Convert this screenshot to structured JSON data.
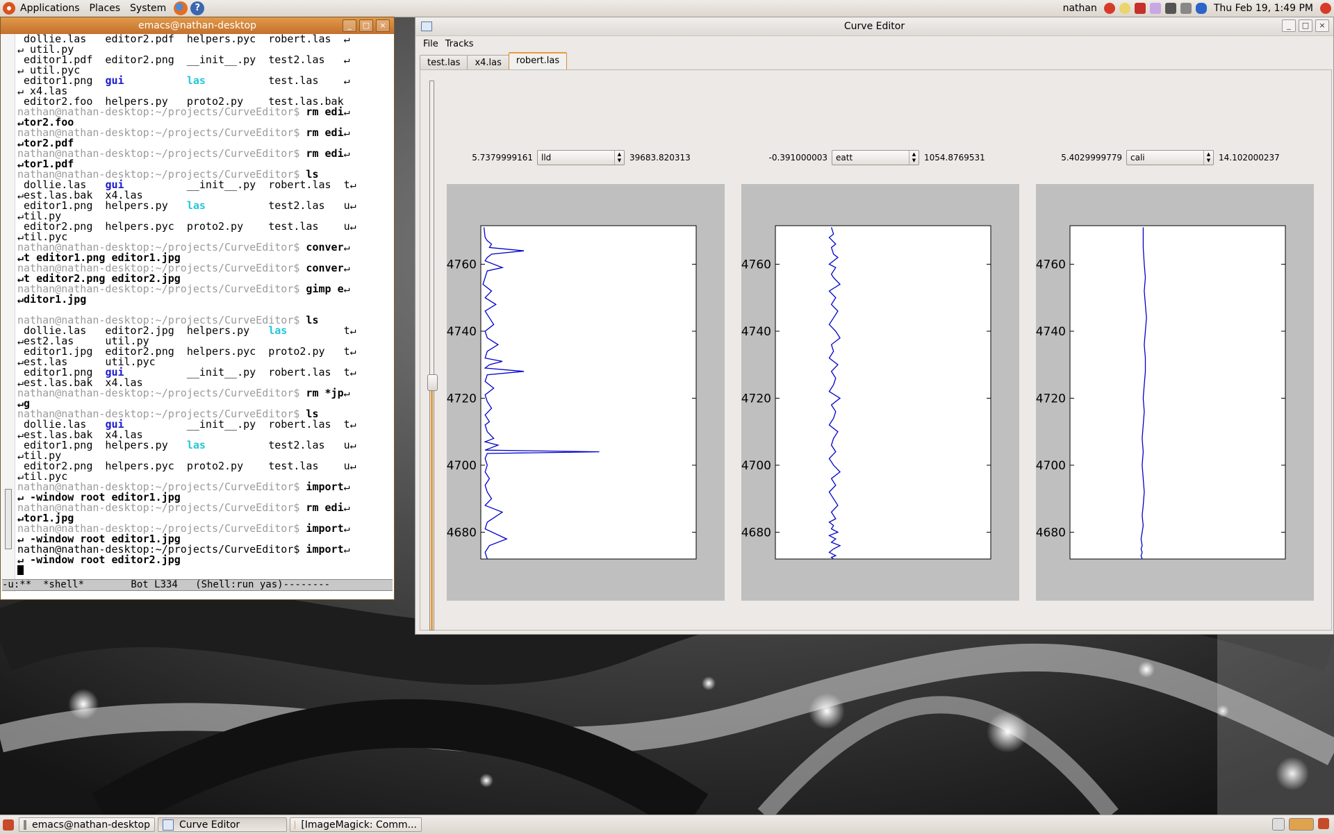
{
  "top_panel": {
    "menus": [
      "Applications",
      "Places",
      "System"
    ],
    "user": "nathan",
    "clock": "Thu Feb 19,  1:49 PM"
  },
  "emacs": {
    "title": "emacs@nathan-desktop",
    "modeline": "-u:**  *shell*        Bot L334   (Shell:run yas)--------",
    "prompt": "nathan@nathan-desktop:~/projects/CurveEditor$ ",
    "lines": [
      [
        [
          "t",
          " dollie.las   editor2.pdf  helpers.pyc  robert.las  "
        ],
        [
          "t",
          "↵"
        ]
      ],
      [
        [
          "t",
          "↵ util.py"
        ]
      ],
      [
        [
          "t",
          " editor1.pdf  editor2.png  __init__.py  test2.las   "
        ],
        [
          "t",
          "↵"
        ]
      ],
      [
        [
          "t",
          "↵ util.pyc"
        ]
      ],
      [
        [
          "t",
          " editor1.png  "
        ],
        [
          "gui",
          "gui"
        ],
        [
          "t",
          "          "
        ],
        [
          "las",
          "las"
        ],
        [
          "t",
          "          test.las    "
        ],
        [
          "t",
          "↵"
        ]
      ],
      [
        [
          "t",
          "↵ x4.las"
        ]
      ],
      [
        [
          "t",
          " editor2.foo  helpers.py   proto2.py    test.las.bak"
        ]
      ],
      [
        [
          "p",
          "prompt"
        ],
        [
          "c",
          "rm edi"
        ],
        [
          "t",
          "↵"
        ]
      ],
      [
        [
          "c",
          "↵tor2.foo"
        ]
      ],
      [
        [
          "p",
          "prompt"
        ],
        [
          "c",
          "rm edi"
        ],
        [
          "t",
          "↵"
        ]
      ],
      [
        [
          "c",
          "↵tor2.pdf"
        ]
      ],
      [
        [
          "p",
          "prompt"
        ],
        [
          "c",
          "rm edi"
        ],
        [
          "t",
          "↵"
        ]
      ],
      [
        [
          "c",
          "↵tor1.pdf"
        ]
      ],
      [
        [
          "p",
          "prompt"
        ],
        [
          "c",
          "ls"
        ]
      ],
      [
        [
          "t",
          " dollie.las   "
        ],
        [
          "gui",
          "gui"
        ],
        [
          "t",
          "          __init__.py  robert.las  t"
        ],
        [
          "t",
          "↵"
        ]
      ],
      [
        [
          "t",
          "↵est.las.bak  x4.las"
        ]
      ],
      [
        [
          "t",
          " editor1.png  helpers.py   "
        ],
        [
          "las",
          "las"
        ],
        [
          "t",
          "          test2.las   u"
        ],
        [
          "t",
          "↵"
        ]
      ],
      [
        [
          "t",
          "↵til.py"
        ]
      ],
      [
        [
          "t",
          " editor2.png  helpers.pyc  proto2.py    test.las    u"
        ],
        [
          "t",
          "↵"
        ]
      ],
      [
        [
          "t",
          "↵til.pyc"
        ]
      ],
      [
        [
          "p",
          "prompt"
        ],
        [
          "c",
          "conver"
        ],
        [
          "t",
          "↵"
        ]
      ],
      [
        [
          "c",
          "↵t editor1.png editor1.jpg"
        ]
      ],
      [
        [
          "p",
          "prompt"
        ],
        [
          "c",
          "conver"
        ],
        [
          "t",
          "↵"
        ]
      ],
      [
        [
          "c",
          "↵t editor2.png editor2.jpg"
        ]
      ],
      [
        [
          "p",
          "prompt"
        ],
        [
          "c",
          "gimp e"
        ],
        [
          "t",
          "↵"
        ]
      ],
      [
        [
          "c",
          "↵ditor1.jpg"
        ]
      ],
      [
        [
          "t",
          ""
        ]
      ],
      [
        [
          "p",
          "prompt"
        ],
        [
          "c",
          "ls"
        ]
      ],
      [
        [
          "t",
          " dollie.las   editor2.jpg  helpers.py   "
        ],
        [
          "las",
          "las"
        ],
        [
          "t",
          "         t"
        ],
        [
          "t",
          "↵"
        ]
      ],
      [
        [
          "t",
          "↵est2.las     util.py"
        ]
      ],
      [
        [
          "t",
          " editor1.jpg  editor2.png  helpers.pyc  proto2.py   t"
        ],
        [
          "t",
          "↵"
        ]
      ],
      [
        [
          "t",
          "↵est.las      util.pyc"
        ]
      ],
      [
        [
          "t",
          " editor1.png  "
        ],
        [
          "gui",
          "gui"
        ],
        [
          "t",
          "          __init__.py  robert.las  t"
        ],
        [
          "t",
          "↵"
        ]
      ],
      [
        [
          "t",
          "↵est.las.bak  x4.las"
        ]
      ],
      [
        [
          "p",
          "prompt"
        ],
        [
          "c",
          "rm *jp"
        ],
        [
          "t",
          "↵"
        ]
      ],
      [
        [
          "c",
          "↵g"
        ]
      ],
      [
        [
          "p",
          "prompt"
        ],
        [
          "c",
          "ls"
        ]
      ],
      [
        [
          "t",
          " dollie.las   "
        ],
        [
          "gui",
          "gui"
        ],
        [
          "t",
          "          __init__.py  robert.las  t"
        ],
        [
          "t",
          "↵"
        ]
      ],
      [
        [
          "t",
          "↵est.las.bak  x4.las"
        ]
      ],
      [
        [
          "t",
          " editor1.png  helpers.py   "
        ],
        [
          "las",
          "las"
        ],
        [
          "t",
          "          test2.las   u"
        ],
        [
          "t",
          "↵"
        ]
      ],
      [
        [
          "t",
          "↵til.py"
        ]
      ],
      [
        [
          "t",
          " editor2.png  helpers.pyc  proto2.py    test.las    u"
        ],
        [
          "t",
          "↵"
        ]
      ],
      [
        [
          "t",
          "↵til.pyc"
        ]
      ],
      [
        [
          "p",
          "prompt"
        ],
        [
          "c",
          "import"
        ],
        [
          "t",
          "↵"
        ]
      ],
      [
        [
          "c",
          "↵ -window root editor1.jpg"
        ]
      ],
      [
        [
          "p",
          "prompt"
        ],
        [
          "c",
          "rm edi"
        ],
        [
          "t",
          "↵"
        ]
      ],
      [
        [
          "c",
          "↵tor1.jpg"
        ]
      ],
      [
        [
          "p",
          "prompt"
        ],
        [
          "c",
          "import"
        ],
        [
          "t",
          "↵"
        ]
      ],
      [
        [
          "c",
          "↵ -window root editor1.jpg"
        ]
      ],
      [
        [
          "t",
          "nathan@nathan-desktop:~/projects/CurveEditor$ "
        ],
        [
          "c",
          "import"
        ],
        [
          "t",
          "↵"
        ]
      ],
      [
        [
          "c",
          "↵ -window root editor2.jpg"
        ]
      ],
      [
        [
          "cursor",
          ""
        ]
      ]
    ]
  },
  "curve_editor": {
    "title": "Curve Editor",
    "menus": [
      "File",
      "Tracks"
    ],
    "tabs": [
      "test.las",
      "x4.las",
      "robert.las"
    ],
    "active_tab": "robert.las",
    "slider_position": 0.55,
    "tracks": [
      {
        "min": "5.7379999161",
        "curve": "lld",
        "max": "39683.820313"
      },
      {
        "min": "-0.391000003",
        "curve": "eatt",
        "max": "1054.8769531"
      },
      {
        "min": "5.4029999779",
        "curve": "cali",
        "max": "14.102000237"
      }
    ],
    "line_color": "#0000cc",
    "accent_color": "#e79a3a"
  },
  "chart_data": [
    {
      "type": "line",
      "ylabel": "",
      "ylim": [
        4672,
        4771.5
      ],
      "xlim": [
        0,
        1
      ],
      "yticks": [
        4680,
        4700,
        4720,
        4740,
        4760
      ],
      "series": [
        {
          "x": [
            0.015,
            0.02,
            0.03,
            0.05,
            0.04,
            0.2,
            0.05,
            0.03,
            0.02,
            0.1,
            0.03,
            0.02,
            0.01,
            0.05,
            0.02,
            0.07,
            0.02,
            0.04,
            0.06,
            0.02,
            0.03,
            0.08,
            0.03,
            0.02,
            0.1,
            0.04,
            0.02,
            0.2,
            0.03,
            0.02,
            0.06,
            0.02,
            0.03,
            0.05,
            0.02,
            0.04,
            0.02,
            0.03,
            0.06,
            0.02,
            0.08,
            0.04,
            0.02,
            0.55,
            0.03,
            0.02,
            0.03,
            0.02,
            0.04,
            0.02,
            0.03,
            0.05,
            0.02,
            0.1,
            0.03,
            0.02,
            0.12,
            0.04,
            0.02,
            0.03
          ],
          "y": [
            4771,
            4768,
            4767,
            4766,
            4765,
            4764,
            4763,
            4762,
            4761,
            4759,
            4758,
            4756,
            4754,
            4752,
            4750,
            4748,
            4746,
            4744,
            4742,
            4740,
            4738,
            4736,
            4734,
            4732,
            4731,
            4730,
            4729,
            4728,
            4727,
            4725,
            4723,
            4721,
            4719,
            4717,
            4715,
            4713,
            4712,
            4710,
            4708,
            4707,
            4706,
            4705,
            4704.5,
            4704,
            4703.5,
            4702,
            4700,
            4698,
            4696,
            4694,
            4692,
            4690,
            4688,
            4686,
            4683,
            4681,
            4678,
            4676,
            4674,
            4672
          ]
        }
      ]
    },
    {
      "type": "line",
      "ylabel": "",
      "ylim": [
        4672,
        4771.5
      ],
      "xlim": [
        0,
        1
      ],
      "yticks": [
        4680,
        4700,
        4720,
        4740,
        4760
      ],
      "series": [
        {
          "x": [
            0.26,
            0.27,
            0.25,
            0.28,
            0.26,
            0.27,
            0.29,
            0.25,
            0.28,
            0.26,
            0.27,
            0.3,
            0.25,
            0.28,
            0.26,
            0.29,
            0.27,
            0.25,
            0.28,
            0.3,
            0.26,
            0.27,
            0.25,
            0.29,
            0.26,
            0.28,
            0.27,
            0.25,
            0.3,
            0.26,
            0.28,
            0.27,
            0.25,
            0.29,
            0.27,
            0.26,
            0.28,
            0.25,
            0.27,
            0.3,
            0.26,
            0.28,
            0.25,
            0.27,
            0.29,
            0.26,
            0.28,
            0.25,
            0.27,
            0.26,
            0.29,
            0.25,
            0.28,
            0.26,
            0.3,
            0.27,
            0.25,
            0.28,
            0.26,
            0.27
          ],
          "y": [
            4771,
            4769,
            4768,
            4766,
            4765,
            4763,
            4762,
            4760,
            4759,
            4757,
            4756,
            4754,
            4752,
            4750,
            4748,
            4746,
            4744,
            4742,
            4740,
            4738,
            4736,
            4734,
            4732,
            4730,
            4728,
            4726,
            4724,
            4722,
            4720,
            4718,
            4716,
            4714,
            4712,
            4710,
            4708,
            4706,
            4704,
            4702,
            4700,
            4698,
            4696,
            4694,
            4692,
            4690,
            4688,
            4686,
            4684,
            4683,
            4682,
            4681,
            4680,
            4679,
            4678,
            4677,
            4676,
            4675,
            4674,
            4673,
            4672.5,
            4672
          ]
        }
      ]
    },
    {
      "type": "line",
      "ylabel": "",
      "ylim": [
        4672,
        4771.5
      ],
      "xlim": [
        0,
        1
      ],
      "yticks": [
        4680,
        4700,
        4720,
        4740,
        4760
      ],
      "series": [
        {
          "x": [
            0.34,
            0.34,
            0.345,
            0.35,
            0.345,
            0.35,
            0.355,
            0.35,
            0.345,
            0.35,
            0.35,
            0.345,
            0.34,
            0.345,
            0.34,
            0.335,
            0.34,
            0.335,
            0.34,
            0.345,
            0.34,
            0.335,
            0.34,
            0.335,
            0.33,
            0.335,
            0.33,
            0.335,
            0.33,
            0.335
          ],
          "y": [
            4771,
            4765,
            4760,
            4756,
            4752,
            4748,
            4744,
            4740,
            4736,
            4732,
            4728,
            4724,
            4720,
            4716,
            4712,
            4708,
            4704,
            4700,
            4696,
            4692,
            4688,
            4685,
            4682,
            4680,
            4678,
            4676,
            4675,
            4674,
            4673,
            4672
          ]
        }
      ]
    }
  ]
}
